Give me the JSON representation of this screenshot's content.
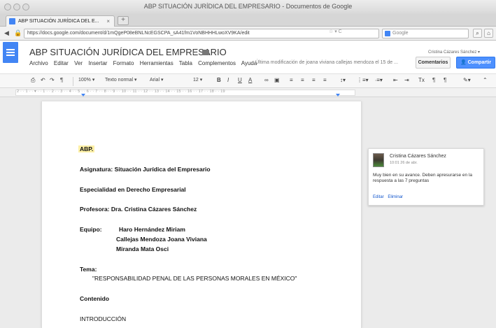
{
  "window": {
    "title": "ABP SITUACIÓN JURÍDICA DEL EMPRESARIO - Documentos de Google"
  },
  "browser": {
    "tab_label": "ABP SITUACIÓN JURÍDICA DEL E...",
    "tab_close": "×",
    "new_tab": "+",
    "url": "https://docs.google.com/document/d/1mQgeP08eBNLNcEGSCPA_sA41fm1VoNBHHHLwoXV9KA/edit",
    "url_controls": "☆ ▾ C",
    "search_placeholder": "Google"
  },
  "docs": {
    "title": "ABP SITUACIÓN JURÍDICA DEL EMPRESARIO",
    "menu": [
      "Archivo",
      "Editar",
      "Ver",
      "Insertar",
      "Formato",
      "Herramientas",
      "Tabla",
      "Complementos",
      "Ayuda"
    ],
    "last_edit": "Última modificación de joana viviana callejas mendoza el 15 de ...",
    "owner": "Cristina Cázares Sánchez ▾",
    "comments_button": "Comentarios",
    "share_button": "Compartir"
  },
  "toolbar": {
    "zoom": "100%",
    "style": "Texto normal",
    "font": "Arial",
    "size": "12",
    "bold": "B",
    "italic": "I",
    "underline": "U",
    "text_color": "A",
    "clear_format": "Tx"
  },
  "ruler": {
    "numbers": "2 · · 1 · · ▾ · · 1 · · 2 · · 3 · · 4 · · 5 · · 6 · · 7 · · 8 · · 9 · · 10 · · 11 · · 12 · · 13 · · 14 · · 15 · · 16 · · 17 · · 18 · · 19"
  },
  "document": {
    "heading": "ABP.",
    "subject": "Asignatura: Situación Jurídica del Empresario",
    "specialty": "Especialidad en Derecho Empresarial",
    "professor": "Profesora: Dra. Cristina Cázares Sánchez",
    "team_label": "Equipo:",
    "team_members": [
      "Haro Hernández Miriam",
      "Callejas Mendoza Joana Viviana",
      "Miranda Mata Osci"
    ],
    "topic_label": "Tema:",
    "topic": "\"RESPONSABILIDAD PENAL DE LAS PERSONAS MORALES EN MÉXICO\"",
    "contents_label": "Contenido",
    "intro": "INTRODUCCIÓN"
  },
  "comment": {
    "author": "Cristina Cázares Sánchez",
    "time": "10:01 26 de abr.",
    "text": "Muy bien en su avance. Deben apresurarse en la respuesta a las 7 preguntas",
    "actions": [
      "Editar",
      "Eliminar"
    ]
  },
  "colors": {
    "docs_blue": "#4285f4",
    "share_blue": "#4d90fe",
    "highlight": "#fdf0a6",
    "link": "#1155cc"
  }
}
